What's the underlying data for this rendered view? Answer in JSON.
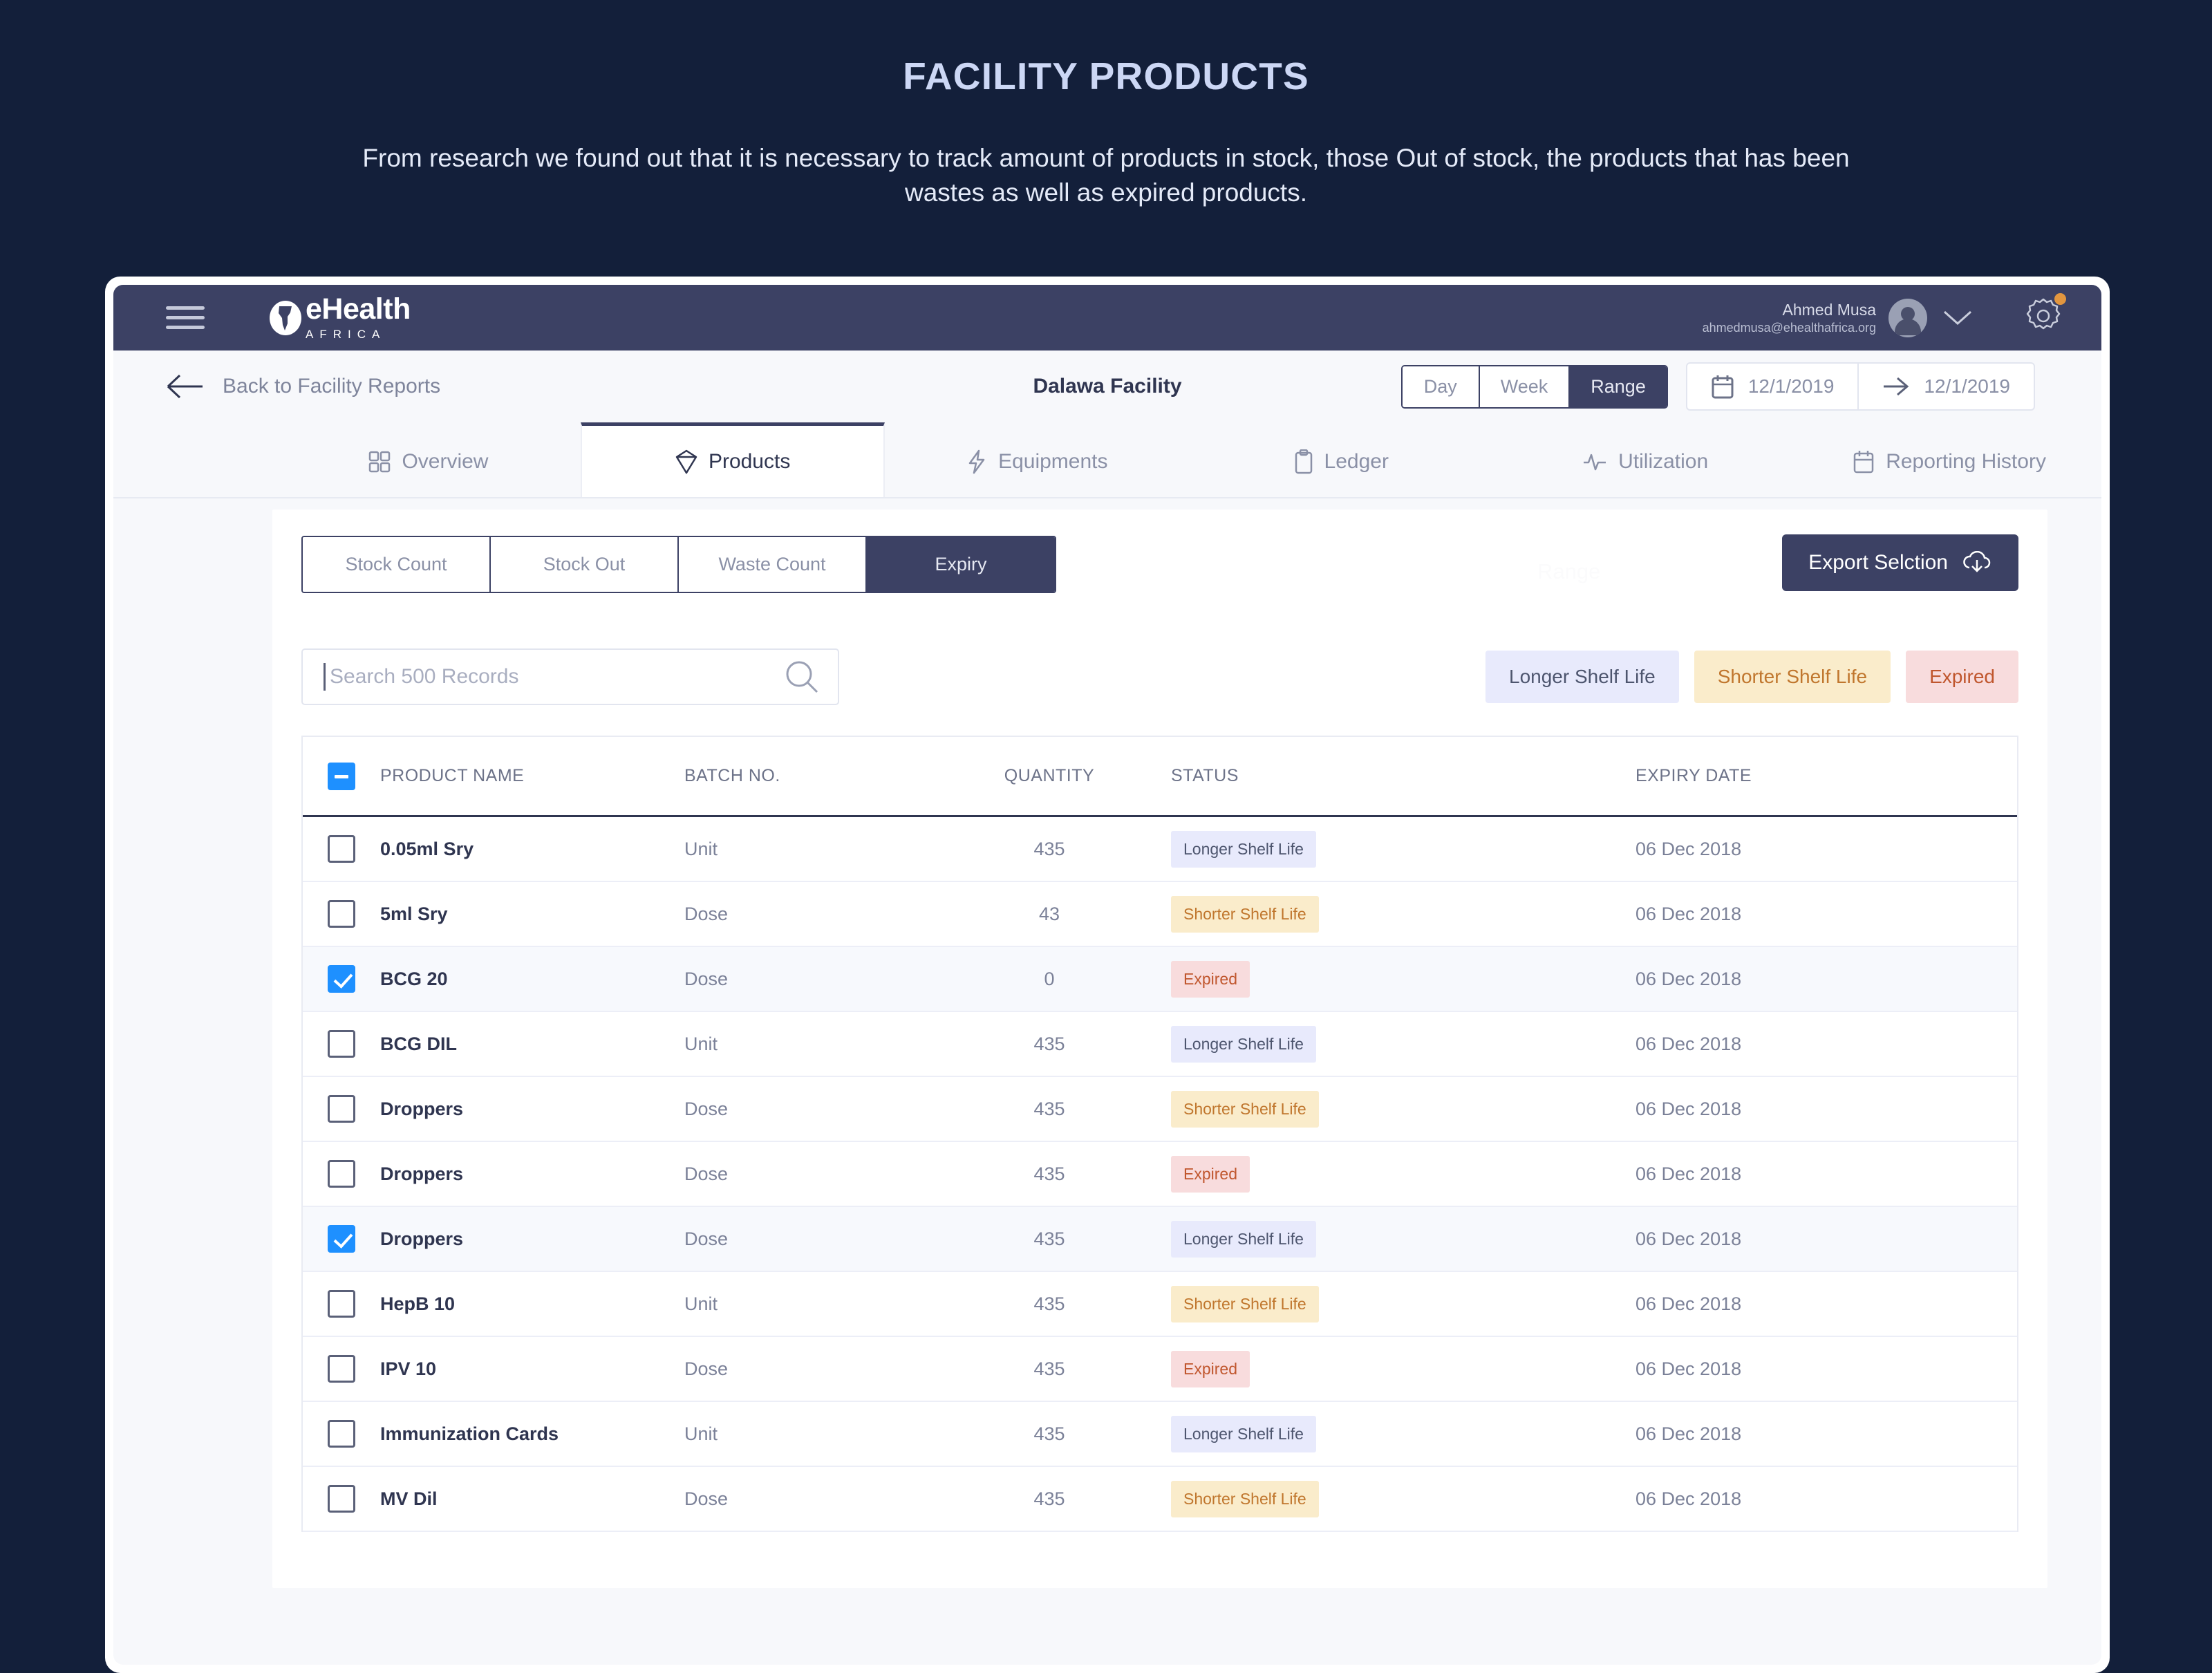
{
  "intro": {
    "title": "FACILITY PRODUCTS",
    "subtitle": "From research we found out that it is necessary to track amount of products in stock, those Out of stock, the products that has been wastes as well as expired products."
  },
  "topbar": {
    "menu_icon": "hamburger-icon",
    "brand_name": "eHealth",
    "brand_sub": "AFRICA",
    "brand_icon": "africa-globe-icon",
    "user_name": "Ahmed Musa",
    "user_email": "ahmedmusa@ehealthafrica.org",
    "avatar_icon": "avatar-icon",
    "chevron_icon": "chevron-down-icon",
    "settings_icon": "gear-icon",
    "notification_color": "#e2963f"
  },
  "subheader": {
    "back_label": "Back to Facility Reports",
    "back_icon": "arrow-left-icon",
    "facility_title": "Dalawa Facility",
    "range_modes": [
      "Day",
      "Week",
      "Range"
    ],
    "active_range_mode": "Range",
    "date_from": "12/1/2019",
    "date_to": "12/1/2019",
    "calendar_icon": "calendar-icon",
    "arrow_icon": "arrow-right-icon"
  },
  "tabs": [
    {
      "label": "Overview",
      "icon": "grid-icon",
      "active": false
    },
    {
      "label": "Products",
      "icon": "box-icon",
      "active": true
    },
    {
      "label": "Equipments",
      "icon": "bolt-icon",
      "active": false
    },
    {
      "label": "Ledger",
      "icon": "clipboard-icon",
      "active": false
    },
    {
      "label": "Utilization",
      "icon": "pulse-icon",
      "active": false
    },
    {
      "label": "Reporting History",
      "icon": "calendar-icon",
      "active": false
    }
  ],
  "subtabs": {
    "items": [
      "Stock Count",
      "Stock Out",
      "Waste Count",
      "Expiry"
    ],
    "active": "Expiry"
  },
  "ghost_text": "Range",
  "export": {
    "label": "Export Selction",
    "icon": "cloud-download-icon"
  },
  "search": {
    "placeholder": "Search 500 Records",
    "value": "",
    "icon": "search-icon"
  },
  "chips": [
    {
      "label": "Longer Shelf Life",
      "style": "longer",
      "bg": "#e8eafc",
      "fg": "#4d556e"
    },
    {
      "label": "Shorter Shelf Life",
      "style": "shorter",
      "bg": "#faeccb",
      "fg": "#c0762d"
    },
    {
      "label": "Expired",
      "style": "expired",
      "bg": "#f8dcdd",
      "fg": "#c0562d"
    }
  ],
  "table": {
    "select_all_state": "indeterminate",
    "columns": [
      "PRODUCT NAME",
      "BATCH NO.",
      "QUANTITY",
      "STATUS",
      "EXPIRY DATE"
    ],
    "rows": [
      {
        "checked": false,
        "name": "0.05ml Sry",
        "batch": "Unit",
        "qty": "435",
        "status": "Longer Shelf Life",
        "status_style": "longer",
        "expiry": "06 Dec 2018"
      },
      {
        "checked": false,
        "name": "5ml Sry",
        "batch": "Dose",
        "qty": "43",
        "status": "Shorter Shelf Life",
        "status_style": "shorter",
        "expiry": "06 Dec 2018"
      },
      {
        "checked": true,
        "name": "BCG 20",
        "batch": "Dose",
        "qty": "0",
        "status": "Expired",
        "status_style": "expired",
        "expiry": "06 Dec 2018"
      },
      {
        "checked": false,
        "name": "BCG DIL",
        "batch": "Unit",
        "qty": "435",
        "status": "Longer Shelf Life",
        "status_style": "longer",
        "expiry": "06 Dec 2018"
      },
      {
        "checked": false,
        "name": "Droppers",
        "batch": "Dose",
        "qty": "435",
        "status": "Shorter Shelf Life",
        "status_style": "shorter",
        "expiry": "06 Dec 2018"
      },
      {
        "checked": false,
        "name": "Droppers",
        "batch": "Dose",
        "qty": "435",
        "status": "Expired",
        "status_style": "expired",
        "expiry": "06 Dec 2018"
      },
      {
        "checked": true,
        "name": "Droppers",
        "batch": "Dose",
        "qty": "435",
        "status": "Longer Shelf Life",
        "status_style": "longer",
        "expiry": "06 Dec 2018"
      },
      {
        "checked": false,
        "name": "HepB 10",
        "batch": "Unit",
        "qty": "435",
        "status": "Shorter Shelf Life",
        "status_style": "shorter",
        "expiry": "06 Dec 2018"
      },
      {
        "checked": false,
        "name": "IPV 10",
        "batch": "Dose",
        "qty": "435",
        "status": "Expired",
        "status_style": "expired",
        "expiry": "06 Dec 2018"
      },
      {
        "checked": false,
        "name": "Immunization Cards",
        "batch": "Unit",
        "qty": "435",
        "status": "Longer Shelf Life",
        "status_style": "longer",
        "expiry": "06 Dec 2018"
      },
      {
        "checked": false,
        "name": "MV Dil",
        "batch": "Dose",
        "qty": "435",
        "status": "Shorter Shelf Life",
        "status_style": "shorter",
        "expiry": "06 Dec 2018"
      }
    ]
  }
}
